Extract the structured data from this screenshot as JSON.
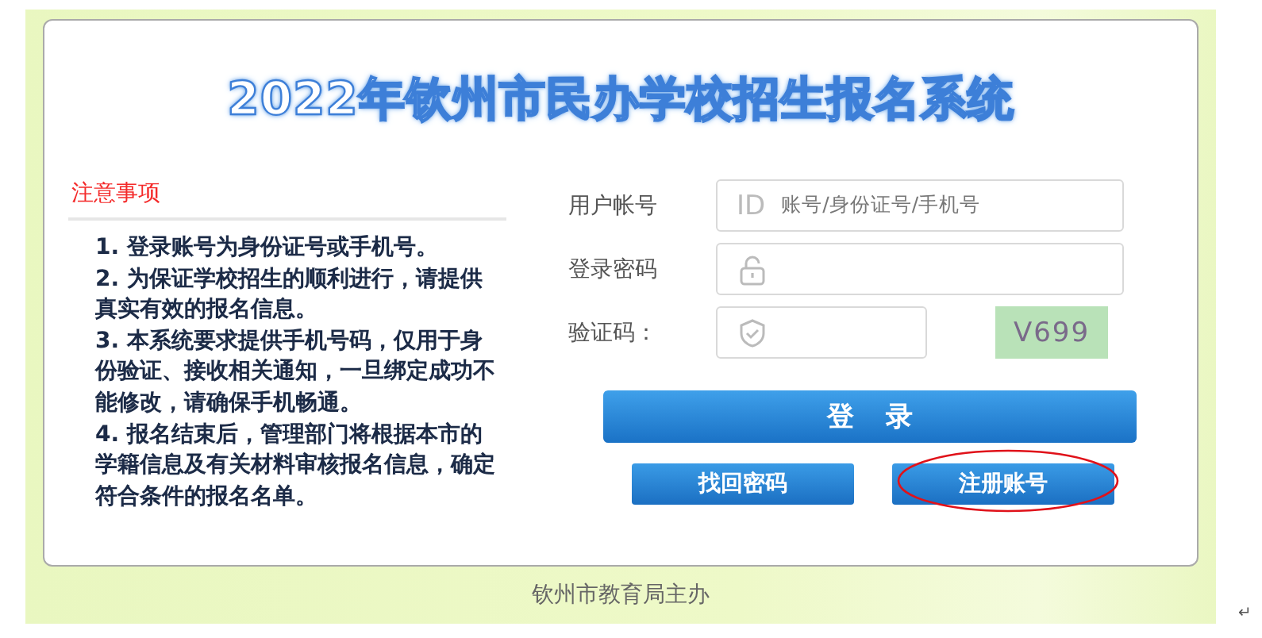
{
  "title": "2022年钦州市民办学校招生报名系统",
  "notes": {
    "heading": "注意事项",
    "items": [
      "1. 登录账号为身份证号或手机号。",
      "2. 为保证学校招生的顺利进行，请提供真实有效的报名信息。",
      "3. 本系统要求提供手机号码，仅用于身份验证、接收相关通知，一旦绑定成功不能修改，请确保手机畅通。",
      "4. 报名结束后，管理部门将根据本市的学籍信息及有关材料审核报名信息，确定符合条件的报名名单。"
    ]
  },
  "form": {
    "fields": [
      {
        "kind": "text",
        "label": "用户帐号",
        "prefix": "ID",
        "placeholder": "账号/身份证号/手机号"
      },
      {
        "kind": "password",
        "label": "登录密码"
      },
      {
        "kind": "captcha",
        "label": "验证码：",
        "captcha": "V699"
      }
    ],
    "login_button": "登 录",
    "buttons": [
      {
        "label": "找回密码",
        "circled": false
      },
      {
        "label": "注册账号",
        "circled": true
      }
    ]
  },
  "footer": "钦州市教育局主办",
  "paragraph_mark": "↵"
}
